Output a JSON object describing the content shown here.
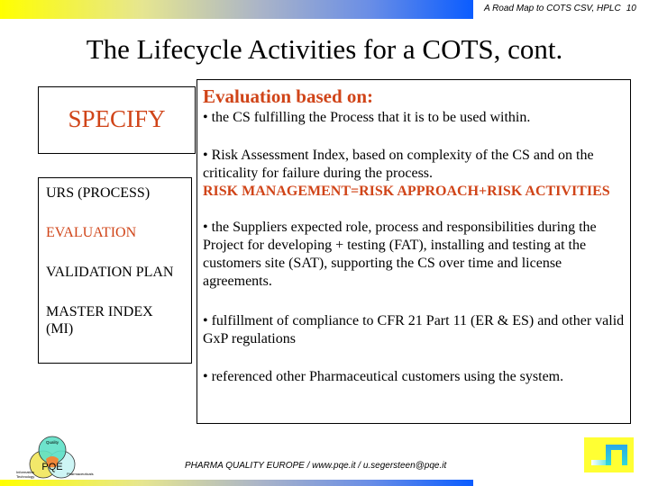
{
  "header": {
    "caption": "A Road Map to COTS CSV, HPLC",
    "page_number": "10"
  },
  "title": "The Lifecycle Activities for a COTS, cont.",
  "left_panel": {
    "specify_label": "SPECIFY",
    "items": [
      {
        "label": "URS (PROCESS)",
        "highlighted": false
      },
      {
        "label": "EVALUATION",
        "highlighted": true
      },
      {
        "label": "VALIDATION PLAN",
        "highlighted": false
      },
      {
        "label": "MASTER INDEX",
        "highlighted": false
      },
      {
        "label": "(MI)",
        "highlighted": false
      }
    ]
  },
  "right_panel": {
    "heading": "Evaluation based on:",
    "bullets": [
      "• the CS fulfilling the Process that it is to be used within.",
      "• Risk Assessment Index, based on complexity of the CS and on the criticality for failure during the process.",
      "• the Suppliers expected role, process  and responsibilities during the Project for developing + testing (FAT), installing and testing at the customers site (SAT),  supporting the CS over time and license agreements.",
      "• fulfillment of compliance to CFR 21 Part 11 (ER & ES) and other valid GxP regulations",
      "• referenced other Pharmaceutical customers using the system."
    ],
    "risk_formula": "RISK MANAGEMENT=RISK APPROACH+RISK ACTIVITIES"
  },
  "logo": {
    "center": "PQE",
    "top_circle": "Quality",
    "left_circle": "Information Technology",
    "right_circle": "Pharmaceuticals"
  },
  "footer": {
    "text": "PHARMA QUALITY EUROPE / www.pqe.it / u.segersteen@pqe.it"
  },
  "colors": {
    "accent_red": "#d04418",
    "gradient_start": "#ffff00",
    "gradient_end": "#0a5cff"
  }
}
